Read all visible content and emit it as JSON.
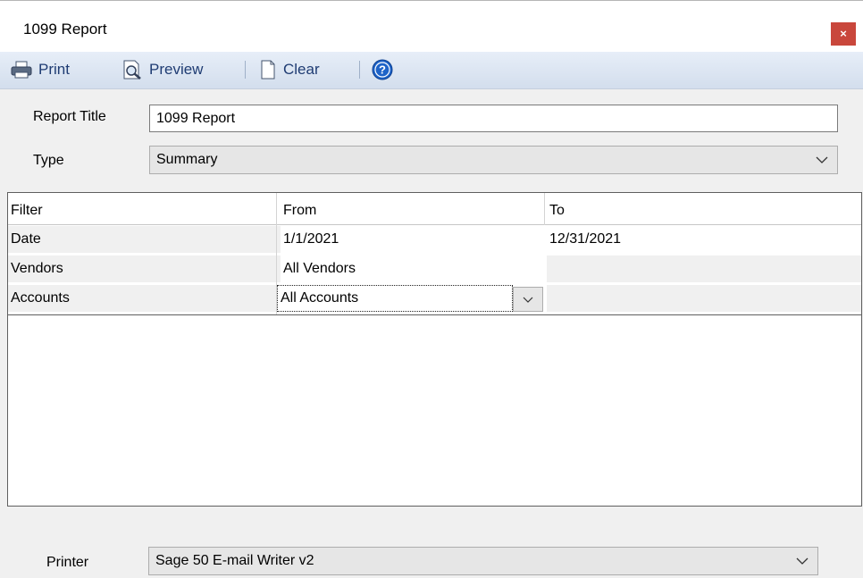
{
  "window": {
    "title": "1099 Report",
    "close_label": "×"
  },
  "toolbar": {
    "print_label": "Print",
    "preview_label": "Preview",
    "clear_label": "Clear",
    "help_icon": "help-icon"
  },
  "form": {
    "report_title_label": "Report Title",
    "report_title_value": "1099 Report",
    "type_label": "Type",
    "type_value": "Summary"
  },
  "filter_grid": {
    "headers": [
      "Filter",
      "From",
      "To"
    ],
    "rows": [
      {
        "filter": "Date",
        "from": "1/1/2021",
        "to": "12/31/2021"
      },
      {
        "filter": "Vendors",
        "from": "All Vendors",
        "to": ""
      },
      {
        "filter": "Accounts",
        "from": "All Accounts",
        "to": ""
      }
    ]
  },
  "printer": {
    "label": "Printer",
    "value": "Sage 50 E-mail Writer v2"
  },
  "colors": {
    "close_button": "#c9473c",
    "toolbar_text": "#1f3c73",
    "help_icon": "#1e63c8"
  }
}
